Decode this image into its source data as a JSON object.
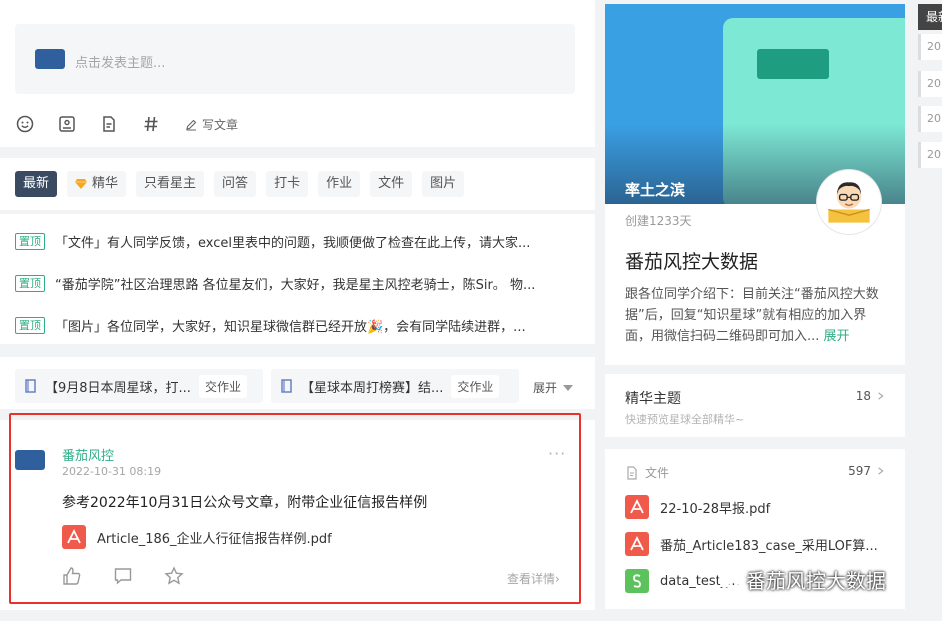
{
  "composer": {
    "placeholder": "点击发表主题...",
    "write_article": "写文章",
    "tools": [
      "emoji-icon",
      "image-icon",
      "file-icon",
      "hashtag-icon"
    ]
  },
  "tabs": [
    "最新",
    "精华",
    "只看星主",
    "问答",
    "打卡",
    "作业",
    "文件",
    "图片"
  ],
  "pinned": {
    "badge": "置顶",
    "items": [
      "「文件」有人同学反馈，excel里表中的问题，我顺便做了检查在此上传，请大家...",
      "“番茄学院”社区治理思路 各位星友们，大家好，我是星主风控老骑士，陈Sir。 物...",
      "「图片」各位同学，大家好，知识星球微信群已经开放🎉，会有同学陆续进群，..."
    ]
  },
  "assignments": {
    "items": [
      {
        "title": "【9月8日本周星球，打...",
        "tag": "交作业"
      },
      {
        "title": "【星球本周打榜赛】结...",
        "tag": "交作业"
      }
    ],
    "expand": "展开"
  },
  "post": {
    "author": "番茄风控",
    "date": "2022-10-31 08:19",
    "body": "参考2022年10月31日公众号文章，附带企业征信报告样例",
    "file": "Article_186_企业人行征信报告样例.pdf",
    "view_detail": "查看详情",
    "more": "···"
  },
  "group": {
    "owner": "率土之滨",
    "created": "创建1233天",
    "title": "番茄风控大数据",
    "desc": "跟各位同学介绍下：目前关注“番茄风控大数据”后，回复“知识星球”就有相应的加入界面，用微信扫码二维码即可加入...",
    "expand": "展开"
  },
  "featured": {
    "title": "精华主题",
    "sub": "快速预览星球全部精华~",
    "count": "18"
  },
  "files": {
    "title": "文件",
    "count": "597",
    "items": [
      {
        "name": "22-10-28早报.pdf",
        "type": "pdf"
      },
      {
        "name": "番茄_Article183_case_采用LOF算...",
        "type": "pdf"
      },
      {
        "name": "data_test_...",
        "type": "xls"
      }
    ]
  },
  "sidebar_right": {
    "head": "最新",
    "items": [
      "20",
      "20",
      "20",
      "20"
    ]
  },
  "watermark": "番茄风控大数据",
  "colors": {
    "accent": "#2fae86",
    "active_tab": "#3a4a61",
    "highlight": "#e8312a",
    "pdf": "#ef5a4b",
    "xls": "#5cc35c"
  }
}
